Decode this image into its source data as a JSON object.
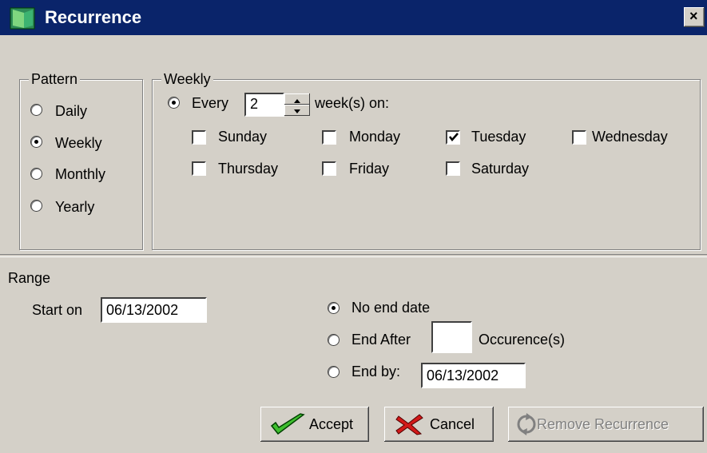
{
  "window": {
    "title": "Recurrence",
    "close_label": "×"
  },
  "pattern": {
    "legend": "Pattern",
    "options": [
      {
        "label": "Daily",
        "selected": false
      },
      {
        "label": "Weekly",
        "selected": true
      },
      {
        "label": "Monthly",
        "selected": false
      },
      {
        "label": "Yearly",
        "selected": false
      }
    ]
  },
  "weekly": {
    "legend": "Weekly",
    "every_label": "Every",
    "every_value": "2",
    "weeks_on_label": "week(s) on:",
    "days": [
      {
        "label": "Sunday",
        "checked": false
      },
      {
        "label": "Monday",
        "checked": false
      },
      {
        "label": "Tuesday",
        "checked": true
      },
      {
        "label": "Wednesday",
        "checked": false
      },
      {
        "label": "Thursday",
        "checked": false
      },
      {
        "label": "Friday",
        "checked": false
      },
      {
        "label": "Saturday",
        "checked": false
      }
    ]
  },
  "range": {
    "title": "Range",
    "start_label": "Start on",
    "start_value": "06/13/2002",
    "no_end_label": "No end date",
    "end_after_label": "End After",
    "end_after_value": "",
    "occurrences_label": "Occurence(s)",
    "end_by_label": "End by:",
    "end_by_value": "06/13/2002"
  },
  "buttons": {
    "accept": "Accept",
    "cancel": "Cancel",
    "remove": "Remove Recurrence"
  }
}
